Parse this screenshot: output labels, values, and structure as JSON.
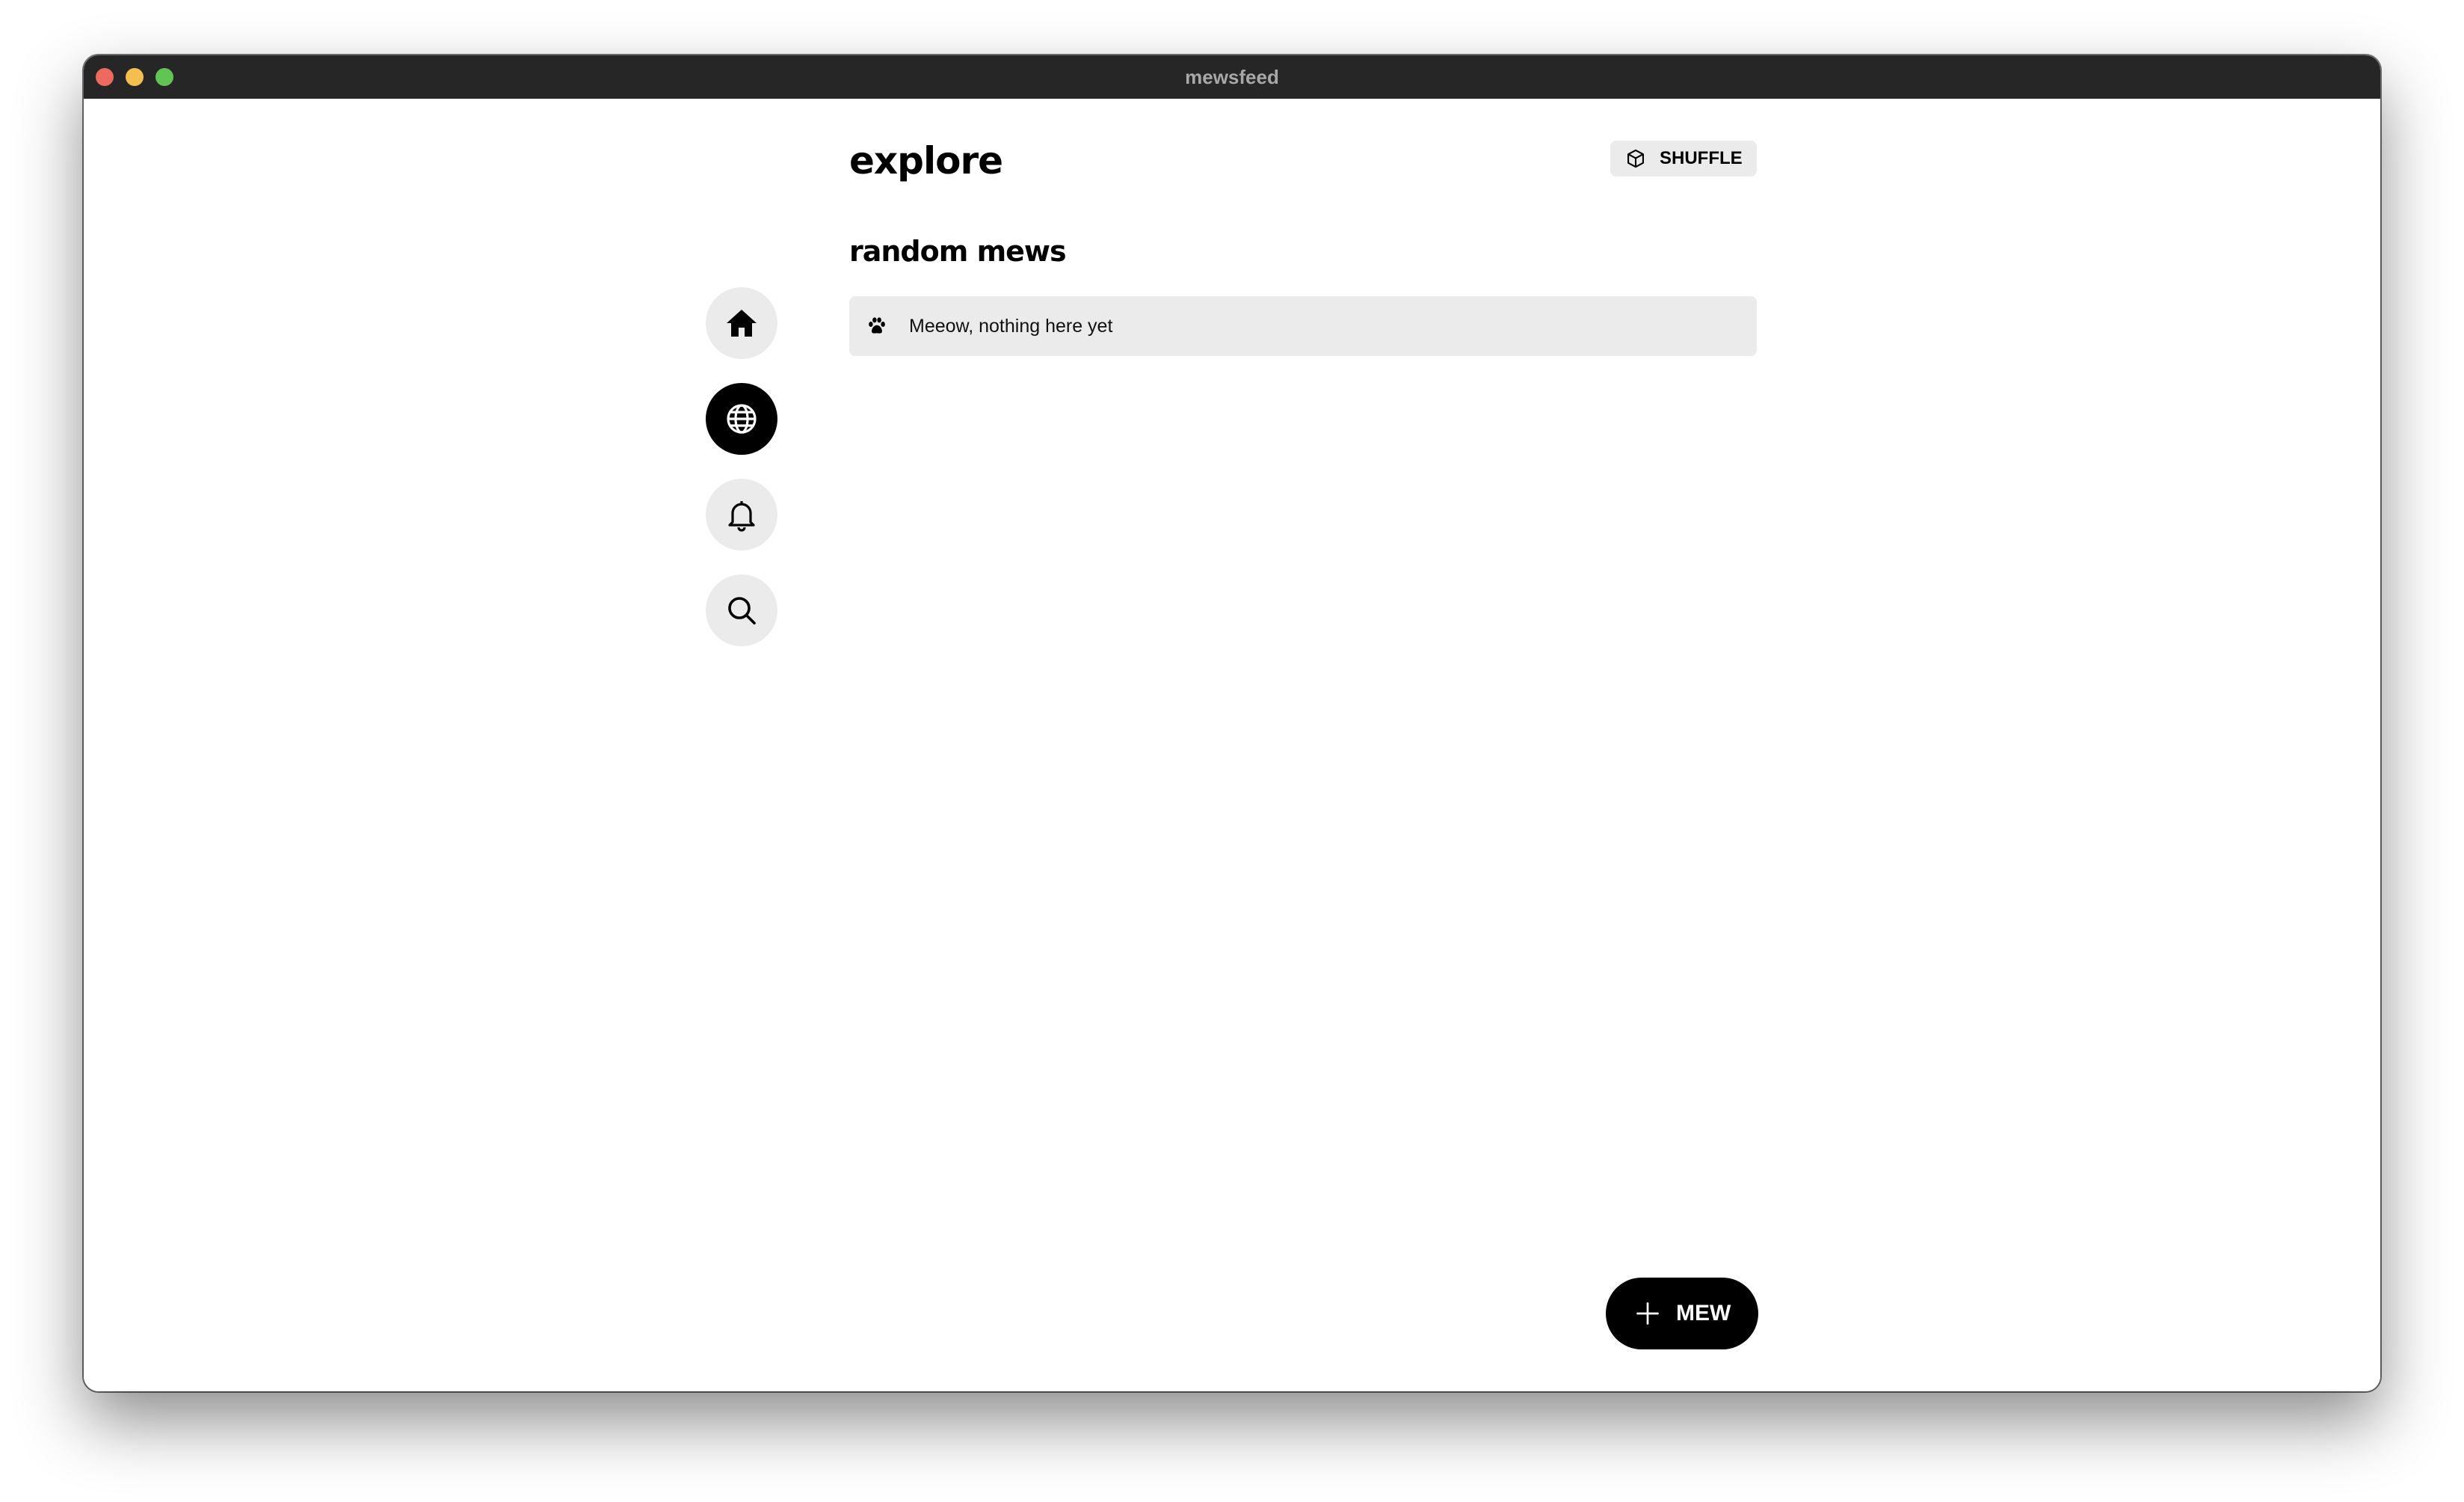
{
  "window": {
    "title": "mewsfeed"
  },
  "sidebar": {
    "items": [
      {
        "name": "home",
        "icon": "home-icon",
        "active": false
      },
      {
        "name": "explore",
        "icon": "globe-icon",
        "active": true
      },
      {
        "name": "notifications",
        "icon": "bell-icon",
        "active": false
      },
      {
        "name": "search",
        "icon": "search-icon",
        "active": false
      }
    ]
  },
  "header": {
    "title": "explore",
    "shuffle_label": "SHUFFLE",
    "shuffle_icon": "cube-icon"
  },
  "main": {
    "section_title": "random mews",
    "empty_message": "Meeow, nothing here yet",
    "empty_icon": "paw-icon"
  },
  "fab": {
    "label": "MEW",
    "icon": "plus-icon"
  },
  "colors": {
    "titlebar": "#262626",
    "pill_background": "#ebebeb",
    "active": "#000000"
  }
}
